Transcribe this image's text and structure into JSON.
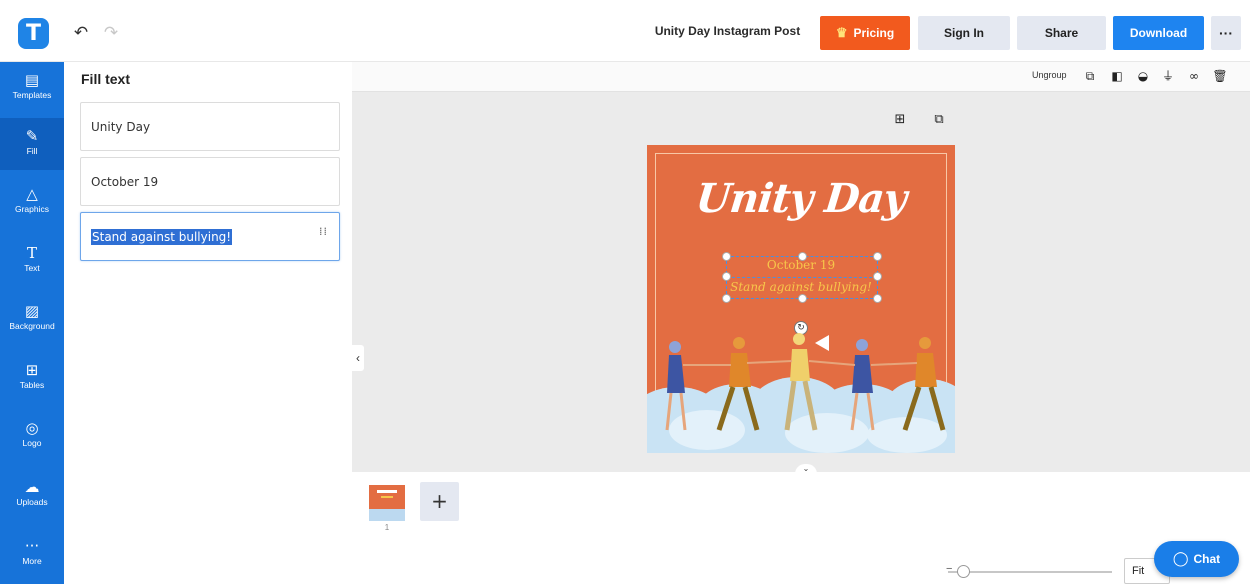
{
  "header": {
    "logo_letter": "T",
    "undo_icon": "undo-icon",
    "redo_icon": "redo-icon",
    "doc_title": "Unity Day Instagram Post",
    "pricing_label": "Pricing",
    "signin_label": "Sign In",
    "share_label": "Share",
    "download_label": "Download",
    "more_label": "···",
    "accent_color": "#1e84f0",
    "pricing_color": "#f25a1e"
  },
  "sidebar": {
    "items": [
      {
        "label": "Templates",
        "icon": "templates-icon"
      },
      {
        "label": "Fill",
        "icon": "pencil-icon"
      },
      {
        "label": "Graphics",
        "icon": "shapes-icon"
      },
      {
        "label": "Text",
        "icon": "text-icon"
      },
      {
        "label": "Background",
        "icon": "background-icon"
      },
      {
        "label": "Tables",
        "icon": "table-icon"
      },
      {
        "label": "Logo",
        "icon": "logo-icon"
      },
      {
        "label": "Uploads",
        "icon": "upload-icon"
      },
      {
        "label": "More",
        "icon": "more-icon"
      }
    ],
    "active": "Fill",
    "color": "#1773d9"
  },
  "panel": {
    "title": "Fill text",
    "fields": [
      {
        "value": "Unity Day"
      },
      {
        "value": "October 19"
      },
      {
        "value": "Stand against bullying!"
      }
    ]
  },
  "toolbar": {
    "ungroup_label": "Ungroup"
  },
  "design": {
    "title": "Unity Day",
    "date": "October 19",
    "tagline": "Stand against bullying!",
    "bg_color": "#e36d42"
  },
  "pages": {
    "current_number": "1",
    "add_label": "+"
  },
  "footer": {
    "fit_label": "Fit",
    "chat_label": "Chat"
  }
}
